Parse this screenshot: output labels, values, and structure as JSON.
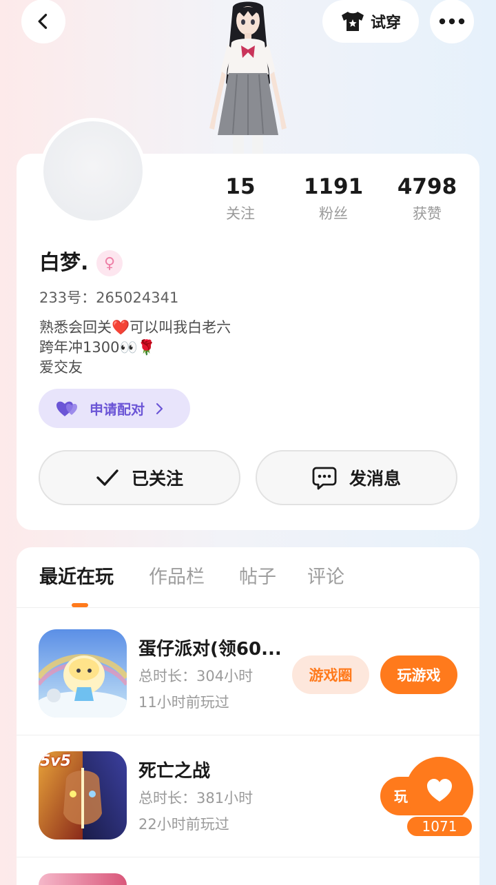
{
  "topbar": {
    "tryon_label": "试穿"
  },
  "stats": [
    {
      "value": "15",
      "label": "关注"
    },
    {
      "value": "1191",
      "label": "粉丝"
    },
    {
      "value": "4798",
      "label": "获赞"
    }
  ],
  "profile": {
    "name": "白梦.",
    "gender_symbol": "♀",
    "uid": "233号：265024341",
    "bio": [
      "熟悉会回关❤️可以叫我白老六",
      "跨年冲1300👀🌹",
      "爱交友"
    ]
  },
  "pair_label": "申请配对",
  "actions": {
    "follow_label": "已关注",
    "message_label": "发消息"
  },
  "tabs": [
    "最近在玩",
    "作品栏",
    "帖子",
    "评论"
  ],
  "games": [
    {
      "title": "蛋仔派对(领60...",
      "duration": "总时长：304小时",
      "last_played": "11小时前玩过",
      "circle_label": "游戏圈",
      "play_label": "玩游戏",
      "badge": ""
    },
    {
      "title": "死亡之战",
      "duration": "总时长：381小时",
      "last_played": "22小时前玩过",
      "play_label": "玩",
      "badge": "5v5"
    }
  ],
  "like_fab": {
    "count": "1071"
  },
  "colors": {
    "accent": "#ff7a1c",
    "pair": "#6b55d6"
  }
}
